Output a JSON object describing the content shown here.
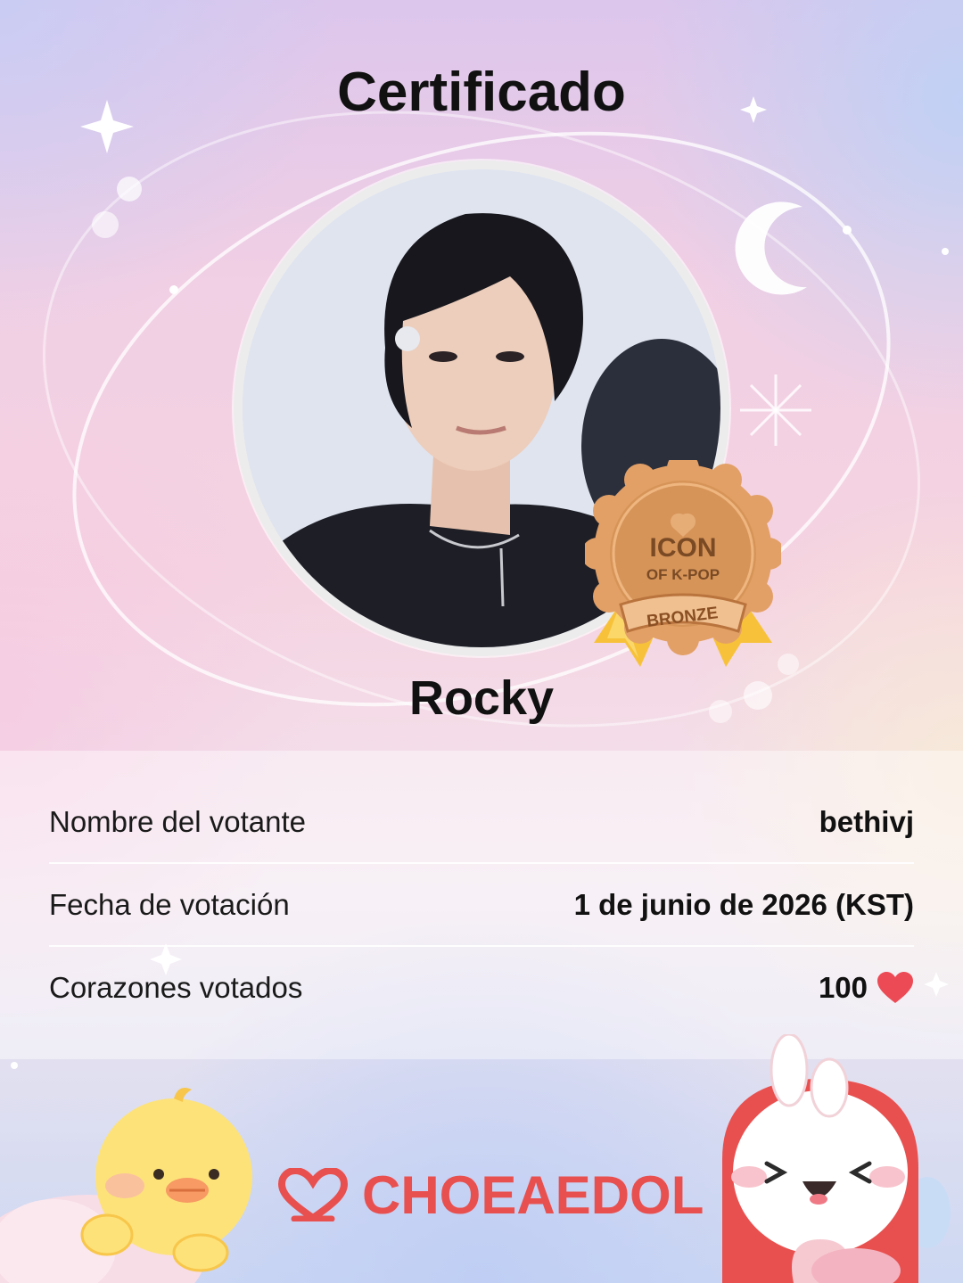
{
  "header": {
    "title": "Certificado"
  },
  "idol": {
    "name": "Rocky",
    "photo_alt": "Rocky photo"
  },
  "badge": {
    "line1": "ICON",
    "line2": "OF K-POP",
    "tier": "BRONZE",
    "color": "#d89a5c"
  },
  "info": {
    "voter_label": "Nombre del votante",
    "voter_value": "bethivj",
    "date_label": "Fecha de votación",
    "date_value": "1 de junio de 2026 (KST)",
    "hearts_label": "Corazones votados",
    "hearts_value": "100",
    "hearts_icon": "heart-icon",
    "heart_color": "#ec4a55"
  },
  "footer": {
    "brand": "CHOEAEDOL",
    "brand_color": "#e8504f",
    "logo_icon": "choeaedol-logo-icon"
  }
}
